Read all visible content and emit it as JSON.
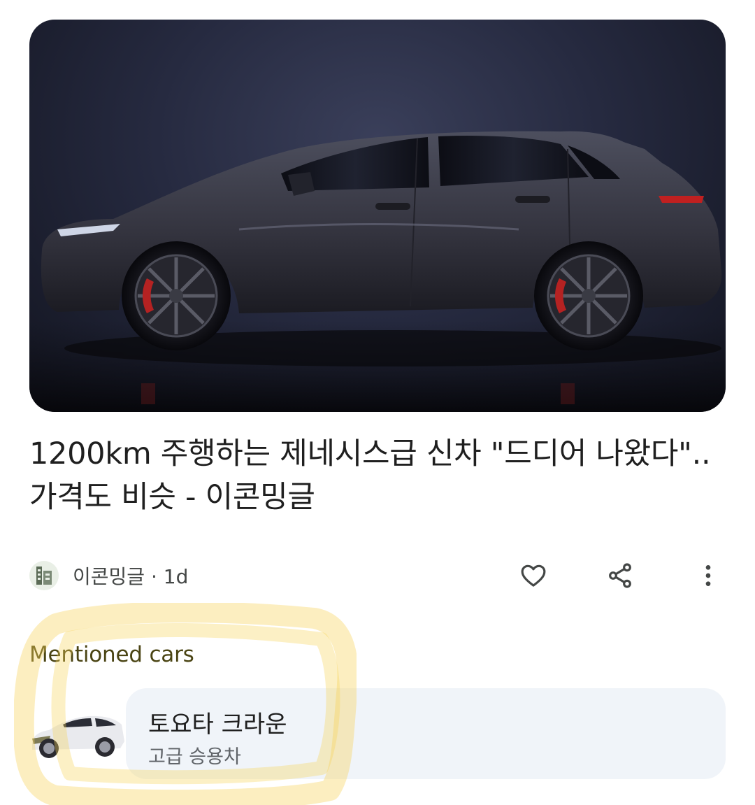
{
  "article": {
    "headline": "1200km 주행하는 제네시스급 신차 \"드디어 나왔다\".. 가격도 비슷 - 이콘밍글",
    "hero_image": "dark-suv-side-profile"
  },
  "source": {
    "name": "이콘밍글",
    "separator": " · ",
    "age": "1d",
    "logo_icon": "building-logo-icon"
  },
  "actions": {
    "like_icon": "heart-icon",
    "share_icon": "share-icon",
    "more_icon": "more-vert-icon"
  },
  "mentioned_cars": {
    "title": "Mentioned cars",
    "items": [
      {
        "name": "토요타 크라운",
        "category": "고급 승용차",
        "thumb_icon": "white-suv-thumbnail"
      }
    ]
  },
  "colors": {
    "section_title": "#4a4413",
    "card_background": "#f0f4f9",
    "highlight": "#f7d35a"
  }
}
